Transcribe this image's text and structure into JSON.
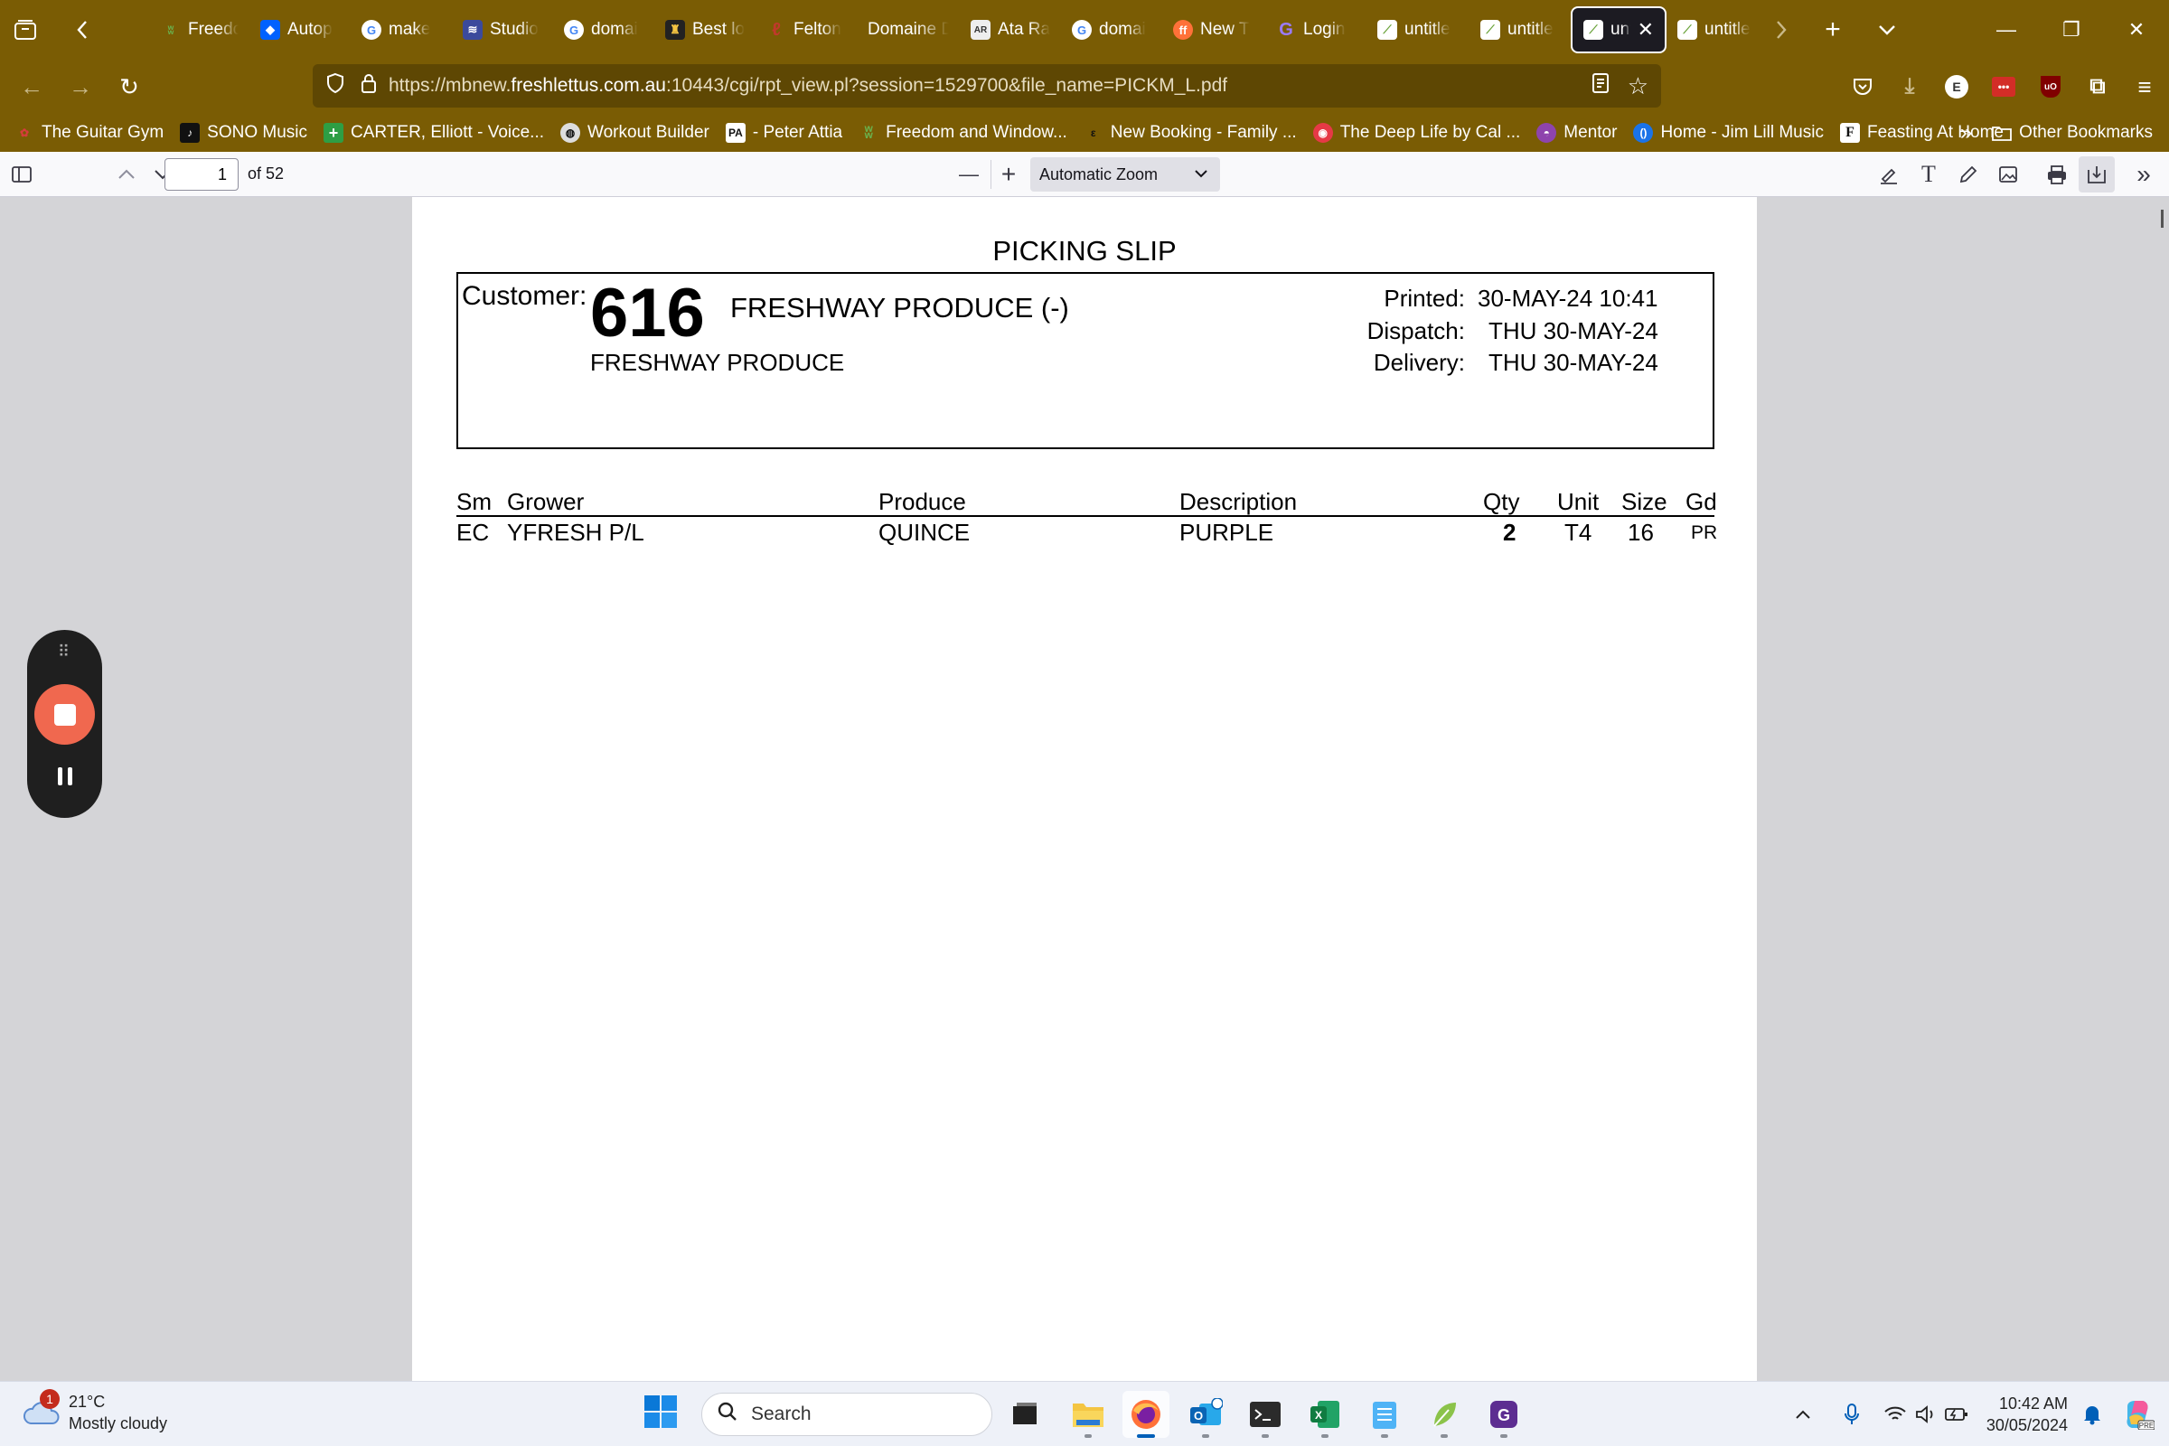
{
  "browser": {
    "tabs": [
      {
        "title": "Freedo",
        "icon": "butterfly-icon",
        "color": "#6ab04c"
      },
      {
        "title": "Autop",
        "icon": "dropbox-icon",
        "color": "#0061ff"
      },
      {
        "title": "make",
        "icon": "google-icon",
        "color": "#ffffff"
      },
      {
        "title": "Studio",
        "icon": "soundwave-icon",
        "color": "#3b4a9c"
      },
      {
        "title": "domai",
        "icon": "google-icon",
        "color": "#ffffff"
      },
      {
        "title": "Best lo",
        "icon": "site-icon",
        "color": "#222222"
      },
      {
        "title": "Felton",
        "icon": "felton-icon",
        "color": "#c0392b"
      },
      {
        "title": "Domaine D",
        "icon": "blank-icon",
        "color": ""
      },
      {
        "title": "Ata Ra",
        "icon": "ar-icon",
        "color": "#eeeeee"
      },
      {
        "title": "domai",
        "icon": "google-icon",
        "color": "#ffffff"
      },
      {
        "title": "New T",
        "icon": "firefox-icon",
        "color": "#ff7139"
      },
      {
        "title": "Login",
        "icon": "g-logo-icon",
        "color": "#7b5cff"
      },
      {
        "title": "untitle",
        "icon": "leaf-icon",
        "color": "#8bc34a"
      },
      {
        "title": "untitle",
        "icon": "leaf-icon",
        "color": "#8bc34a"
      },
      {
        "title": "unt",
        "icon": "leaf-icon",
        "color": "#8bc34a",
        "active": true
      },
      {
        "title": "untitle",
        "icon": "leaf-icon",
        "color": "#8bc34a"
      }
    ],
    "url_prefix": "https://mbnew.",
    "url_host": "freshlettus.com.au",
    "url_rest": ":10443/cgi/rpt_view.pl?session=1529700&file_name=PICKM_L.pdf",
    "bookmarks": [
      {
        "label": "The Guitar Gym",
        "icon": "guitar-icon",
        "color": "#d63c3c"
      },
      {
        "label": "SONO Music",
        "icon": "sono-icon",
        "color": "#111111"
      },
      {
        "label": "CARTER, Elliott - Voice...",
        "icon": "plus-icon",
        "color": "#2e9e44"
      },
      {
        "label": "Workout Builder",
        "icon": "globe-icon",
        "color": "#333333"
      },
      {
        "label": "- Peter Attia",
        "icon": "pa-icon",
        "color": "#ffffff"
      },
      {
        "label": "Freedom and Window...",
        "icon": "butterfly-icon",
        "color": "#6ab04c"
      },
      {
        "label": "New Booking - Family ...",
        "icon": "booking-icon",
        "color": "#333333"
      },
      {
        "label": "The Deep Life by Cal ...",
        "icon": "deeplife-icon",
        "color": "#e63946"
      },
      {
        "label": "Mentor",
        "icon": "mentor-icon",
        "color": "#8e44ad"
      },
      {
        "label": "Home - Jim Lill Music",
        "icon": "jimlill-icon",
        "color": "#1a73e8"
      },
      {
        "label": "Feasting At Home",
        "icon": "f-icon",
        "color": "#ffffff"
      }
    ],
    "other_bookmarks": "Other Bookmarks",
    "accent": "#7a5c04"
  },
  "pdf_toolbar": {
    "page_number": "1",
    "page_count": "of 52",
    "zoom": "Automatic Zoom"
  },
  "document": {
    "title": "PICKING SLIP",
    "customer_label": "Customer:",
    "customer_number": "616",
    "customer_name": "FRESHWAY PRODUCE (-)",
    "customer_sub": "FRESHWAY PRODUCE",
    "printed_label": "Printed:",
    "printed_value": "30-MAY-24 10:41",
    "dispatch_label": "Dispatch:",
    "dispatch_value": "THU 30-MAY-24",
    "delivery_label": "Delivery:",
    "delivery_value": "THU 30-MAY-24",
    "columns": {
      "sm": "Sm",
      "grower": "Grower",
      "produce": "Produce",
      "description": "Description",
      "qty": "Qty",
      "unit": "Unit",
      "size": "Size",
      "gd": "Gd"
    },
    "rows": [
      {
        "sm": "EC",
        "grower": "YFRESH P/L",
        "produce": "QUINCE",
        "description": "PURPLE",
        "qty": "2",
        "unit": "T4",
        "size": "16",
        "gd": "PR"
      }
    ]
  },
  "taskbar": {
    "weather_temp": "21°C",
    "weather_desc": "Mostly cloudy",
    "weather_badge": "1",
    "search_placeholder": "Search",
    "time": "10:42 AM",
    "date": "30/05/2024"
  }
}
